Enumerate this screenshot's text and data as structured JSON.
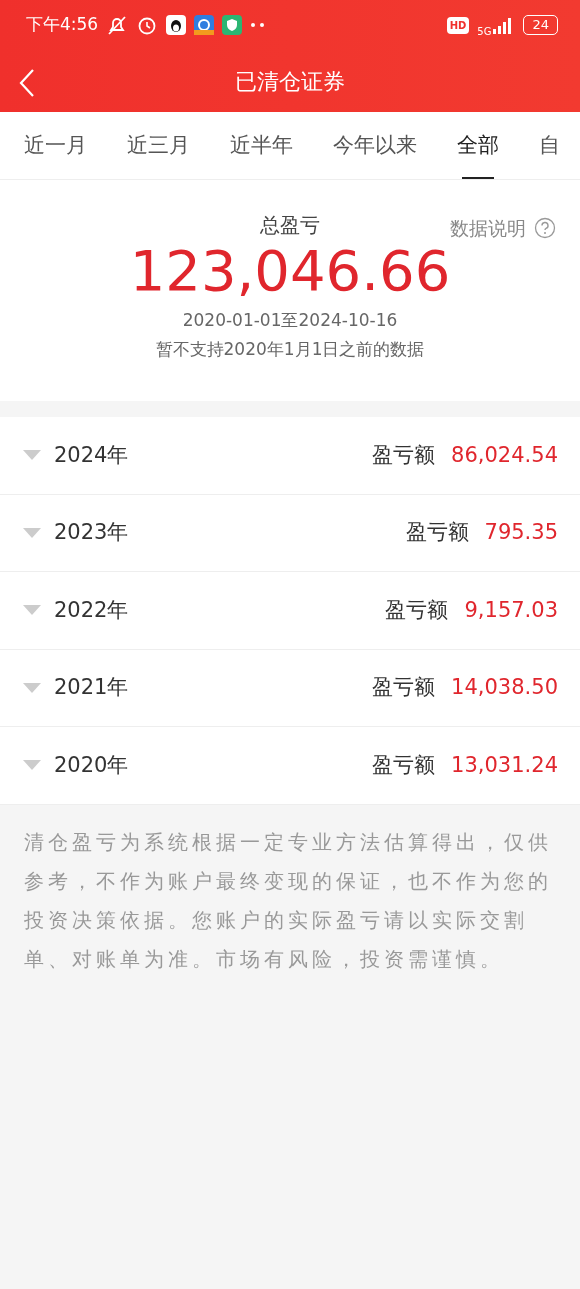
{
  "status_bar": {
    "time": "下午4:56",
    "hd": "HD",
    "network": "5G",
    "battery": "24"
  },
  "header": {
    "title": "已清仓证券"
  },
  "tabs": [
    {
      "label": "近一月",
      "selected": false
    },
    {
      "label": "近三月",
      "selected": false
    },
    {
      "label": "近半年",
      "selected": false
    },
    {
      "label": "今年以来",
      "selected": false
    },
    {
      "label": "全部",
      "selected": true
    },
    {
      "label": "自",
      "selected": false
    }
  ],
  "summary": {
    "label": "总盈亏",
    "help": "数据说明",
    "total": "123,046.66",
    "range": "2020-01-01至2024-10-16",
    "note": "暂不支持2020年1月1日之前的数据"
  },
  "years": [
    {
      "year": "2024年",
      "label": "盈亏额",
      "value": "86,024.54"
    },
    {
      "year": "2023年",
      "label": "盈亏额",
      "value": "795.35"
    },
    {
      "year": "2022年",
      "label": "盈亏额",
      "value": "9,157.03"
    },
    {
      "year": "2021年",
      "label": "盈亏额",
      "value": "14,038.50"
    },
    {
      "year": "2020年",
      "label": "盈亏额",
      "value": "13,031.24"
    }
  ],
  "disclaimer": "清仓盈亏为系统根据一定专业方法估算得出，仅供参考，不作为账户最终变现的保证，也不作为您的投资决策依据。您账户的实际盈亏请以实际交割单、对账单为准。市场有风险，投资需谨慎。"
}
